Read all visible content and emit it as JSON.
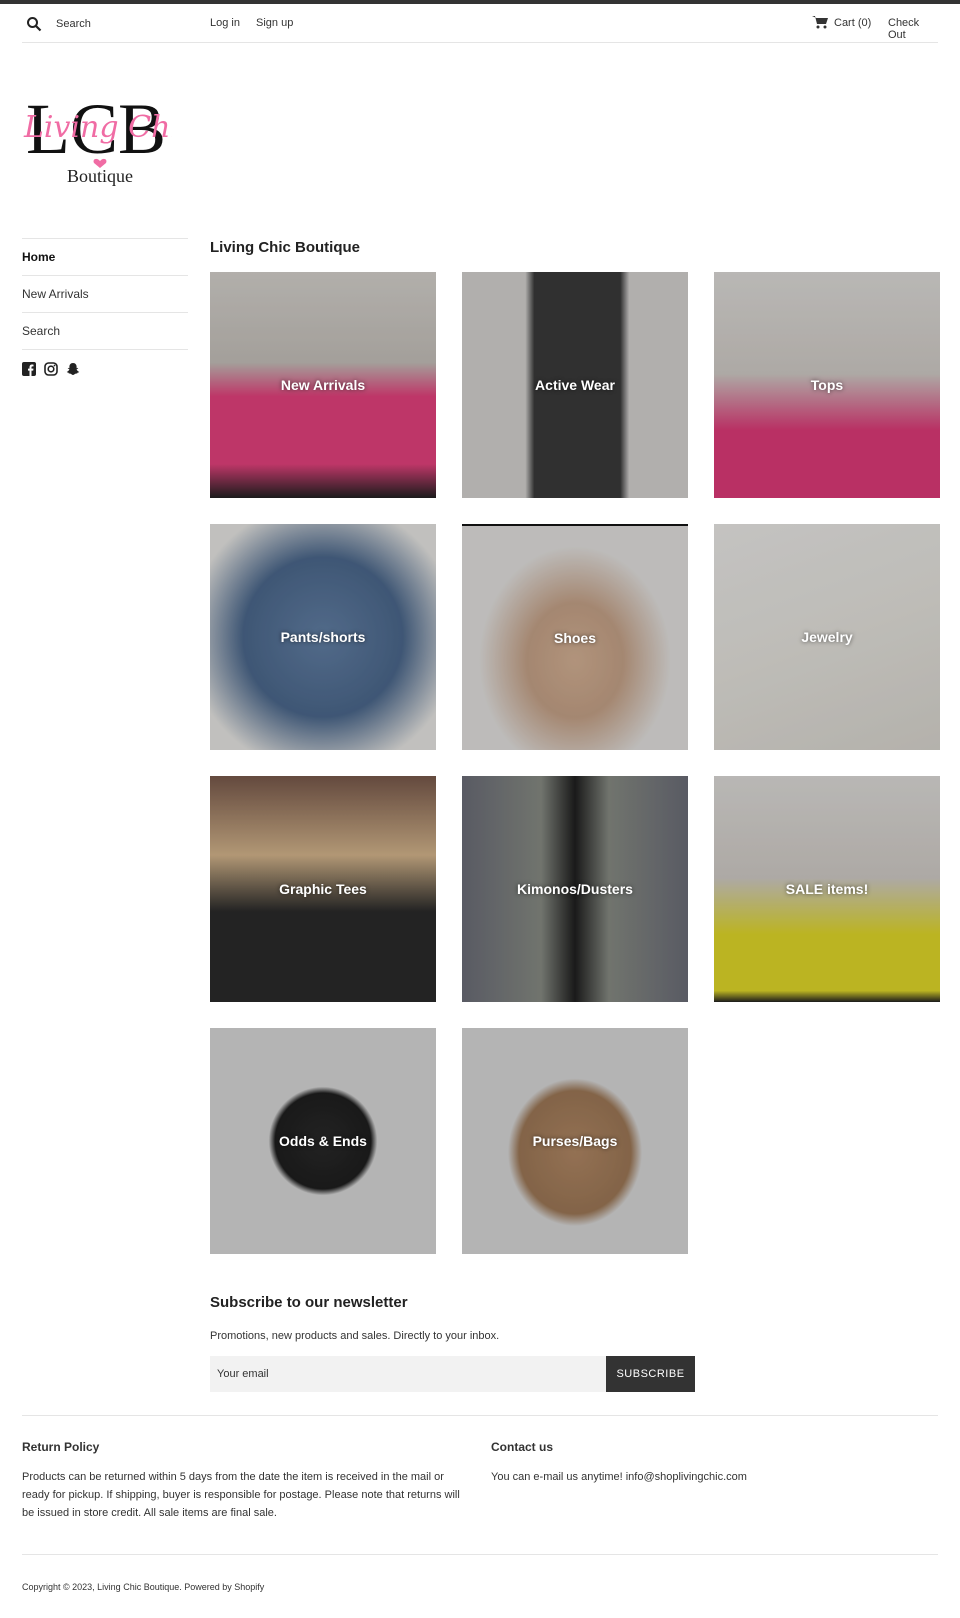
{
  "header": {
    "search_placeholder": "Search",
    "login": "Log in",
    "signup": "Sign up",
    "cart": "Cart (0)",
    "checkout": "Check Out"
  },
  "logo": {
    "letters": "LCB",
    "script": "Living Chic",
    "sub": "Boutique",
    "colors": {
      "script": "#f06ca4",
      "letters": "#111111"
    }
  },
  "sidenav": {
    "items": [
      {
        "label": "Home",
        "active": true
      },
      {
        "label": "New Arrivals",
        "active": false
      },
      {
        "label": "Search",
        "active": false
      }
    ],
    "social": [
      "facebook-icon",
      "instagram-icon",
      "snapchat-icon"
    ]
  },
  "main": {
    "title": "Living Chic Boutique",
    "collections": [
      {
        "label": "New Arrivals",
        "tone": "#e8437f"
      },
      {
        "label": "Active Wear",
        "tone": "#3b3b3b"
      },
      {
        "label": "Tops",
        "tone": "#e23b7a"
      },
      {
        "label": "Pants/shorts",
        "tone": "#4d6a8f"
      },
      {
        "label": "Shoes",
        "tone": "#c9a58a"
      },
      {
        "label": "Jewelry",
        "tone": "#e8e6e0"
      },
      {
        "label": "Graphic Tees",
        "tone": "#2b2b2b"
      },
      {
        "label": "Kimonos/Dusters",
        "tone": "#6d6f7a"
      },
      {
        "label": "SALE items!",
        "tone": "#e5dc2a"
      },
      {
        "label": "Odds & Ends",
        "tone": "#1f1f1f"
      },
      {
        "label": "Purses/Bags",
        "tone": "#a07a58"
      }
    ]
  },
  "newsletter": {
    "title": "Subscribe to our newsletter",
    "description": "Promotions, new products and sales. Directly to your inbox.",
    "email_placeholder": "Your email",
    "button": "SUBSCRIBE"
  },
  "footer": {
    "return_title": "Return Policy",
    "return_text": "Products can be returned within 5 days from the date the item is received in the mail or ready for pickup. If shipping, buyer is responsible for postage. Please note that returns will be issued in store credit. All sale items are final sale.",
    "contact_title": "Contact us",
    "contact_text": "You can e-mail us anytime! info@shoplivingchic.com",
    "copyright": "Copyright © 2023, Living Chic Boutique. Powered by Shopify"
  }
}
